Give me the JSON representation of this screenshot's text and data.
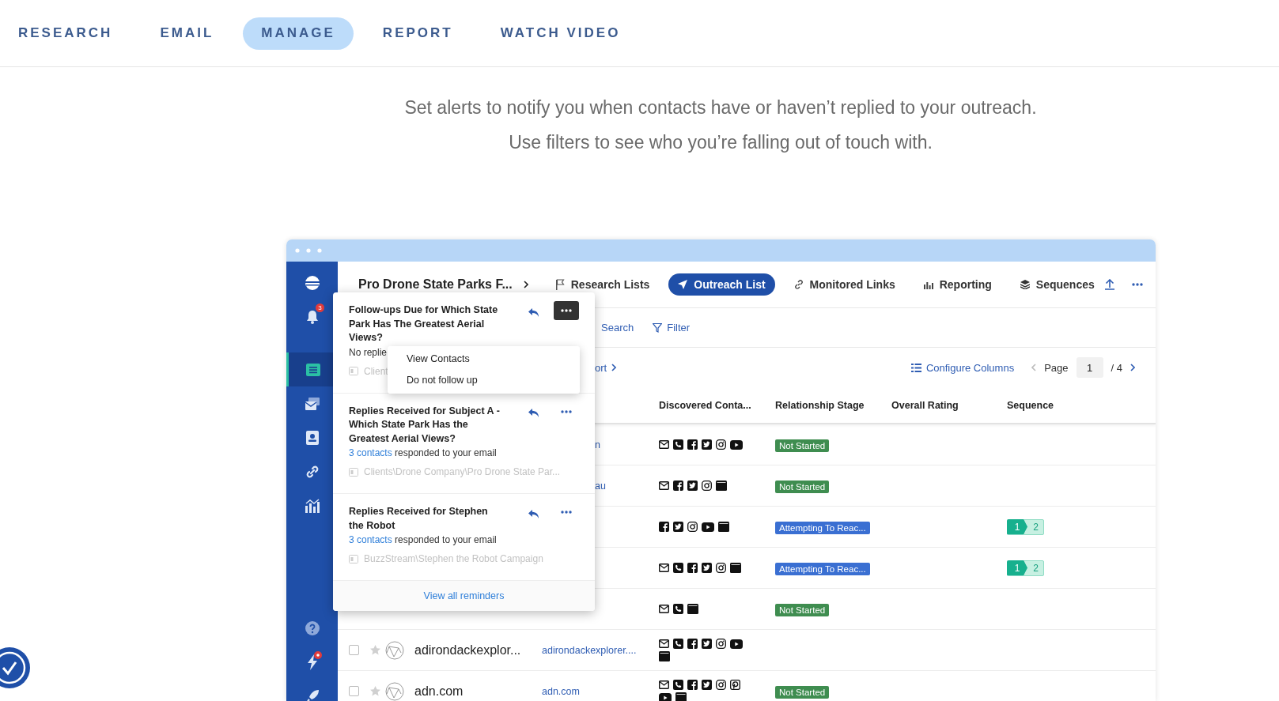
{
  "nav": {
    "tabs": [
      {
        "label": "RESEARCH",
        "selected": false
      },
      {
        "label": "EMAIL",
        "selected": false
      },
      {
        "label": "MANAGE",
        "selected": true
      },
      {
        "label": "REPORT",
        "selected": false
      },
      {
        "label": "WATCH VIDEO",
        "selected": false
      }
    ]
  },
  "intro": {
    "lines": [
      "Set alerts to notify you when contacts have or haven’t replied to your outreach.",
      "Use filters to see who you’re falling out of touch with."
    ]
  },
  "app": {
    "sidebar": {
      "items": [
        {
          "kind": "logo",
          "selected": false
        },
        {
          "kind": "bell",
          "selected": false,
          "badge": "3"
        },
        {
          "kind": "list",
          "selected": true
        },
        {
          "kind": "inbox",
          "selected": false
        },
        {
          "kind": "contacts",
          "selected": false
        },
        {
          "kind": "link",
          "selected": false
        },
        {
          "kind": "chart",
          "selected": false
        },
        {
          "kind": "help",
          "selected": false
        },
        {
          "kind": "bolt",
          "selected": false,
          "alert": true
        },
        {
          "kind": "rocket",
          "selected": false
        }
      ]
    },
    "header": {
      "title": "Pro Drone State Parks F...",
      "tabs": [
        {
          "label": "Research Lists",
          "kind": "flag",
          "selected": false
        },
        {
          "label": "Outreach List",
          "kind": "send",
          "selected": true
        },
        {
          "label": "Monitored Links",
          "kind": "link",
          "selected": false
        },
        {
          "label": "Reporting",
          "kind": "chart",
          "selected": false
        },
        {
          "label": "Sequences",
          "kind": "layers",
          "selected": false
        }
      ]
    },
    "toolbar": {
      "search": "Search",
      "filter": "Filter"
    },
    "subbar": {
      "export": "ort",
      "configure": "Configure Columns",
      "page_label": "Page",
      "page": "1",
      "page_total": "/ 4"
    },
    "table": {
      "columns": [
        "Discovered Conta...",
        "Relationship Stage",
        "Overall Rating",
        "Sequence"
      ],
      "rows": [
        {
          "url": "n",
          "contacts": [
            {
              "kind": "email"
            },
            {
              "kind": "phone"
            },
            {
              "kind": "facebook"
            },
            {
              "kind": "twitter"
            },
            {
              "kind": "instagram"
            },
            {
              "kind": "youtube"
            }
          ],
          "stage": {
            "label": "Not Started",
            "color": "#3f8d50"
          }
        },
        {
          "url": "au",
          "contacts": [
            {
              "kind": "email"
            },
            {
              "kind": "facebook"
            },
            {
              "kind": "twitter"
            },
            {
              "kind": "instagram"
            },
            {
              "kind": "web"
            }
          ],
          "stage": {
            "label": "Not Started",
            "color": "#3f8d50"
          }
        },
        {
          "contacts": [
            {
              "kind": "facebook"
            },
            {
              "kind": "twitter"
            },
            {
              "kind": "instagram"
            },
            {
              "kind": "youtube"
            },
            {
              "kind": "web"
            }
          ],
          "stage": {
            "label": "Attempting To Reac...",
            "color": "#3a6fd2"
          },
          "sequence": [
            {
              "label": "1",
              "done": true
            },
            {
              "label": "2",
              "done": false
            }
          ]
        },
        {
          "contacts": [
            {
              "kind": "email"
            },
            {
              "kind": "phone"
            },
            {
              "kind": "facebook"
            },
            {
              "kind": "twitter"
            },
            {
              "kind": "instagram"
            },
            {
              "kind": "web"
            }
          ],
          "stage": {
            "label": "Attempting To Reac...",
            "color": "#3a6fd2"
          },
          "sequence": [
            {
              "label": "1",
              "done": true
            },
            {
              "label": "2",
              "done": false
            }
          ]
        },
        {
          "contacts": [
            {
              "kind": "email"
            },
            {
              "kind": "phone"
            },
            {
              "kind": "web"
            }
          ],
          "stage": {
            "label": "Not Started",
            "color": "#3f8d50"
          }
        },
        {
          "checked": false,
          "starred": false,
          "name": "adirondackexplor...",
          "url": "adirondackexplorer....",
          "contacts": [
            {
              "kind": "email"
            },
            {
              "kind": "phone"
            },
            {
              "kind": "facebook"
            },
            {
              "kind": "twitter"
            },
            {
              "kind": "instagram"
            },
            {
              "kind": "youtube"
            },
            {
              "kind": "web"
            }
          ]
        },
        {
          "checked": false,
          "starred": false,
          "name": "adn.com",
          "url": "adn.com",
          "contacts": [
            {
              "kind": "email"
            },
            {
              "kind": "phone"
            },
            {
              "kind": "facebook"
            },
            {
              "kind": "twitter"
            },
            {
              "kind": "instagram"
            },
            {
              "kind": "pinterest"
            },
            {
              "kind": "youtube"
            },
            {
              "kind": "web"
            }
          ],
          "stage": {
            "label": "Not Started",
            "color": "#3f8d50"
          }
        }
      ]
    },
    "reminders": {
      "items": [
        {
          "title": "Follow-ups Due for Which State Park Has The Greatest Aerial Views?",
          "text": "No replie",
          "path": "Client",
          "menu_open": true
        },
        {
          "title": "Replies Received for Subject A - Which State Park Has the Greatest Aerial Views?",
          "link": "3 contacts",
          "text": "responded to your email",
          "path": "Clients\\Drone Company\\Pro Drone State Par...",
          "menu_open": false
        },
        {
          "title": "Replies Received for Stephen the Robot",
          "link": "3 contacts",
          "text": "responded to your email",
          "path": "BuzzStream\\Stephen the Robot Campaign",
          "menu_open": false
        }
      ],
      "menu": [
        "View Contacts",
        "Do not follow up"
      ],
      "footer": "View all reminders"
    }
  }
}
